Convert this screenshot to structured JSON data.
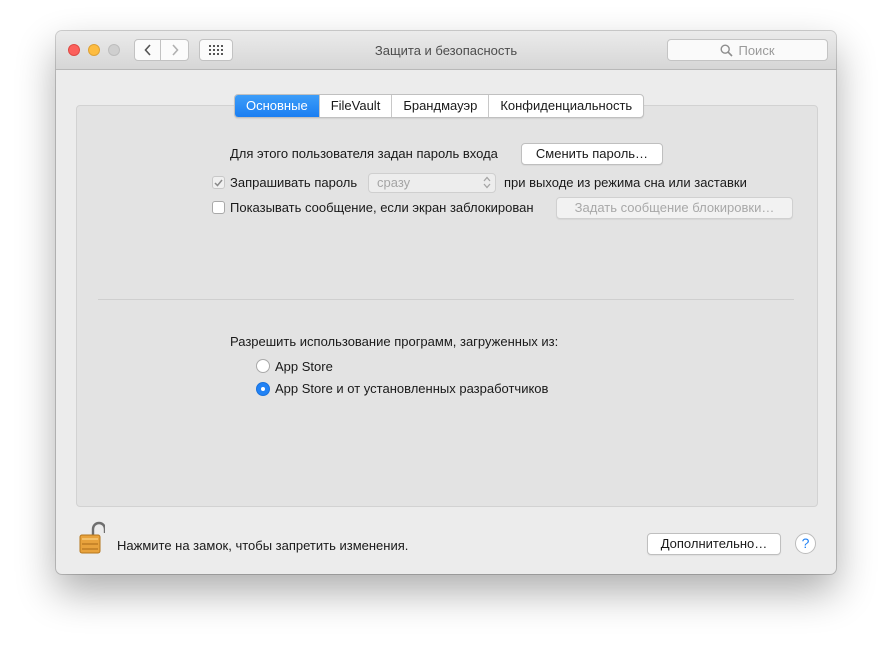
{
  "window": {
    "title": "Защита и безопасность",
    "search_placeholder": "Поиск"
  },
  "icons": {
    "close": "traffic-light-close-icon",
    "minimize": "traffic-light-minimize-icon",
    "zoom": "traffic-light-zoom-icon",
    "back": "chevron-left-icon",
    "forward": "chevron-right-icon",
    "show_all": "grid-icon",
    "search": "magnifier-icon",
    "lock": "open-padlock-icon",
    "help": "question-icon"
  },
  "tabs": [
    {
      "label": "Основные",
      "active": true
    },
    {
      "label": "FileVault",
      "active": false
    },
    {
      "label": "Брандмауэр",
      "active": false
    },
    {
      "label": "Конфиденциальность",
      "active": false
    }
  ],
  "general": {
    "password_text": "Для этого пользователя задан пароль входа",
    "change_password_button": "Сменить пароль…",
    "require_password": {
      "label": "Запрашивать пароль",
      "checked": true,
      "select_value": "сразу",
      "suffix": "при выходе из режима сна или заставки"
    },
    "show_message": {
      "label": "Показывать сообщение, если экран заблокирован",
      "checked": false,
      "button": "Задать сообщение блокировки…"
    },
    "allow_apps": {
      "heading": "Разрешить использование программ, загруженных из:",
      "options": [
        {
          "label": "App Store",
          "selected": false
        },
        {
          "label": "App Store и от установленных разработчиков",
          "selected": true
        }
      ]
    }
  },
  "footer": {
    "lock_text": "Нажмите на замок, чтобы запретить изменения.",
    "advanced_button": "Дополнительно…",
    "help_label": "?"
  },
  "colors": {
    "accent": "#2182f5",
    "close": "#fc605c",
    "minimize": "#fdbc40",
    "lock_body": "#e8a23c"
  }
}
